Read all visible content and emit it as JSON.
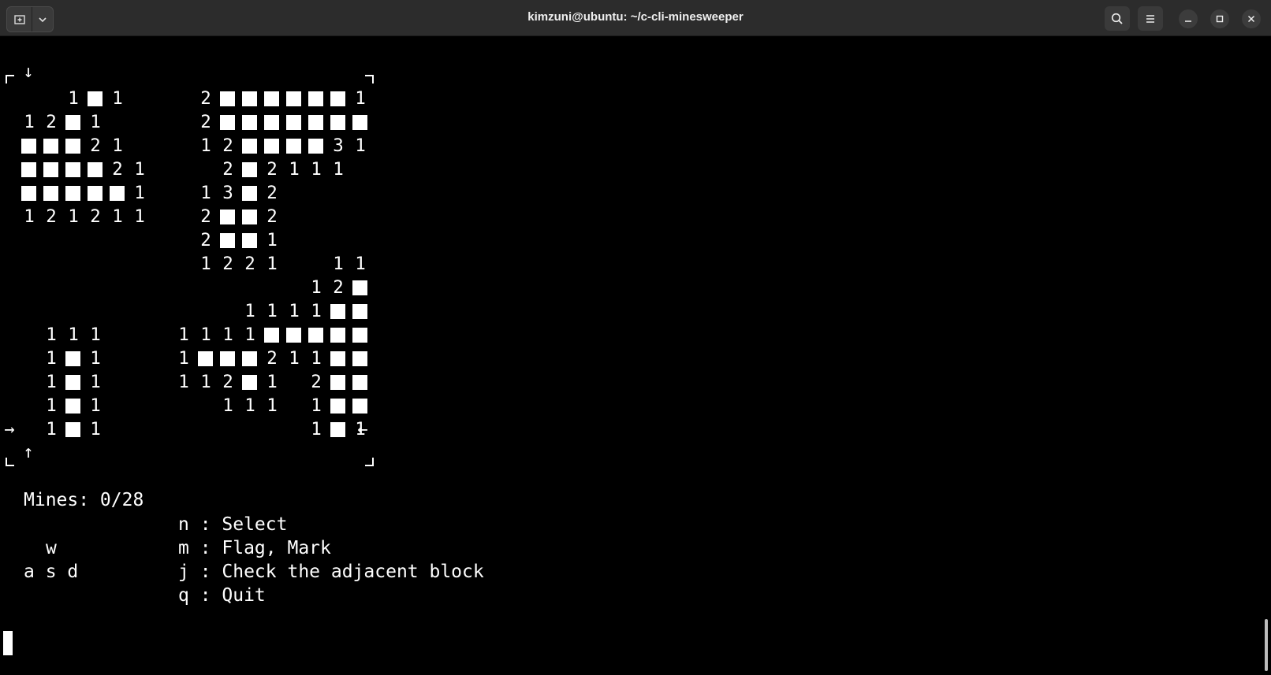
{
  "window": {
    "title": "kimzuni@ubuntu: ~/c-cli-minesweeper",
    "icons": [
      "new-tab-icon",
      "chevron-down-icon",
      "search-icon",
      "menu-icon",
      "minimize-icon",
      "maximize-icon",
      "close-icon"
    ]
  },
  "board": {
    "cols": 16,
    "rows": [
      "  1#1   2######1",
      "12#1    2#######",
      "###21   12####31",
      "####21   2#2111 ",
      "#####1  13#2    ",
      "121211  2##2    ",
      "        2##1    ",
      "        1221  11",
      "             12#",
      "          1111##",
      " 111   1111#####",
      " 1#1   1###211##",
      " 1#1   112#1 2##",
      " 1#1     111 1##",
      " 1#1         1#1"
    ],
    "markers": {
      "top_arrow": "↓",
      "bottom_arrow": "↑",
      "left_arrow": "→",
      "right_arrow": "←"
    }
  },
  "status": {
    "mines": "Mines: 0/28"
  },
  "controls": {
    "keys_top": "w",
    "keys_bottom": "a s d",
    "help": [
      "n : Select",
      "m : Flag, Mark",
      "j : Check the adjacent block",
      "q : Quit"
    ]
  }
}
